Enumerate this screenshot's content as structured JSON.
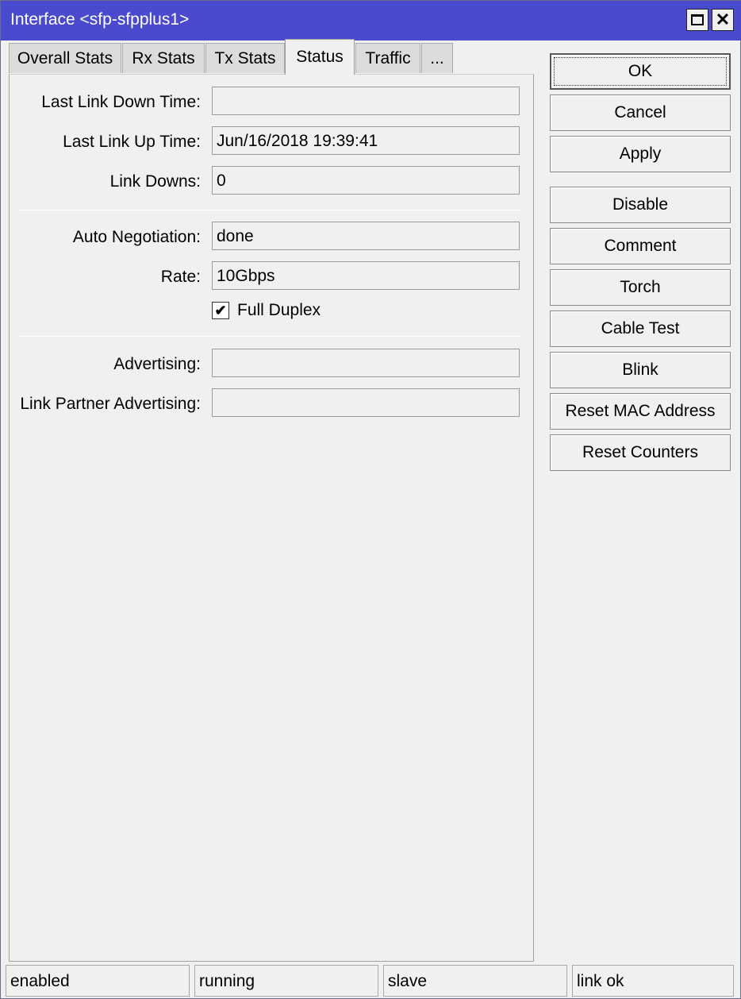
{
  "window": {
    "title": "Interface <sfp-sfpplus1>"
  },
  "tabs": [
    {
      "label": "Overall Stats"
    },
    {
      "label": "Rx Stats"
    },
    {
      "label": "Tx Stats"
    },
    {
      "label": "Status",
      "active": true
    },
    {
      "label": "Traffic"
    },
    {
      "label": "..."
    }
  ],
  "status_tab": {
    "last_link_down_time": {
      "label": "Last Link Down Time:",
      "value": ""
    },
    "last_link_up_time": {
      "label": "Last Link Up Time:",
      "value": "Jun/16/2018 19:39:41"
    },
    "link_downs": {
      "label": "Link Downs:",
      "value": "0"
    },
    "auto_negotiation": {
      "label": "Auto Negotiation:",
      "value": "done"
    },
    "rate": {
      "label": "Rate:",
      "value": "10Gbps"
    },
    "full_duplex": {
      "label": "Full Duplex",
      "checked": true
    },
    "advertising": {
      "label": "Advertising:",
      "value": ""
    },
    "link_partner_advertising": {
      "label": "Link Partner Advertising:",
      "value": ""
    }
  },
  "buttons": {
    "ok": "OK",
    "cancel": "Cancel",
    "apply": "Apply",
    "disable": "Disable",
    "comment": "Comment",
    "torch": "Torch",
    "cable_test": "Cable Test",
    "blink": "Blink",
    "reset_mac": "Reset MAC Address",
    "reset_counters": "Reset Counters"
  },
  "statusbar": [
    "enabled",
    "running",
    "slave",
    "link ok"
  ],
  "colors": {
    "titlebar": "#4a4ace",
    "background": "#f0f0f0"
  }
}
